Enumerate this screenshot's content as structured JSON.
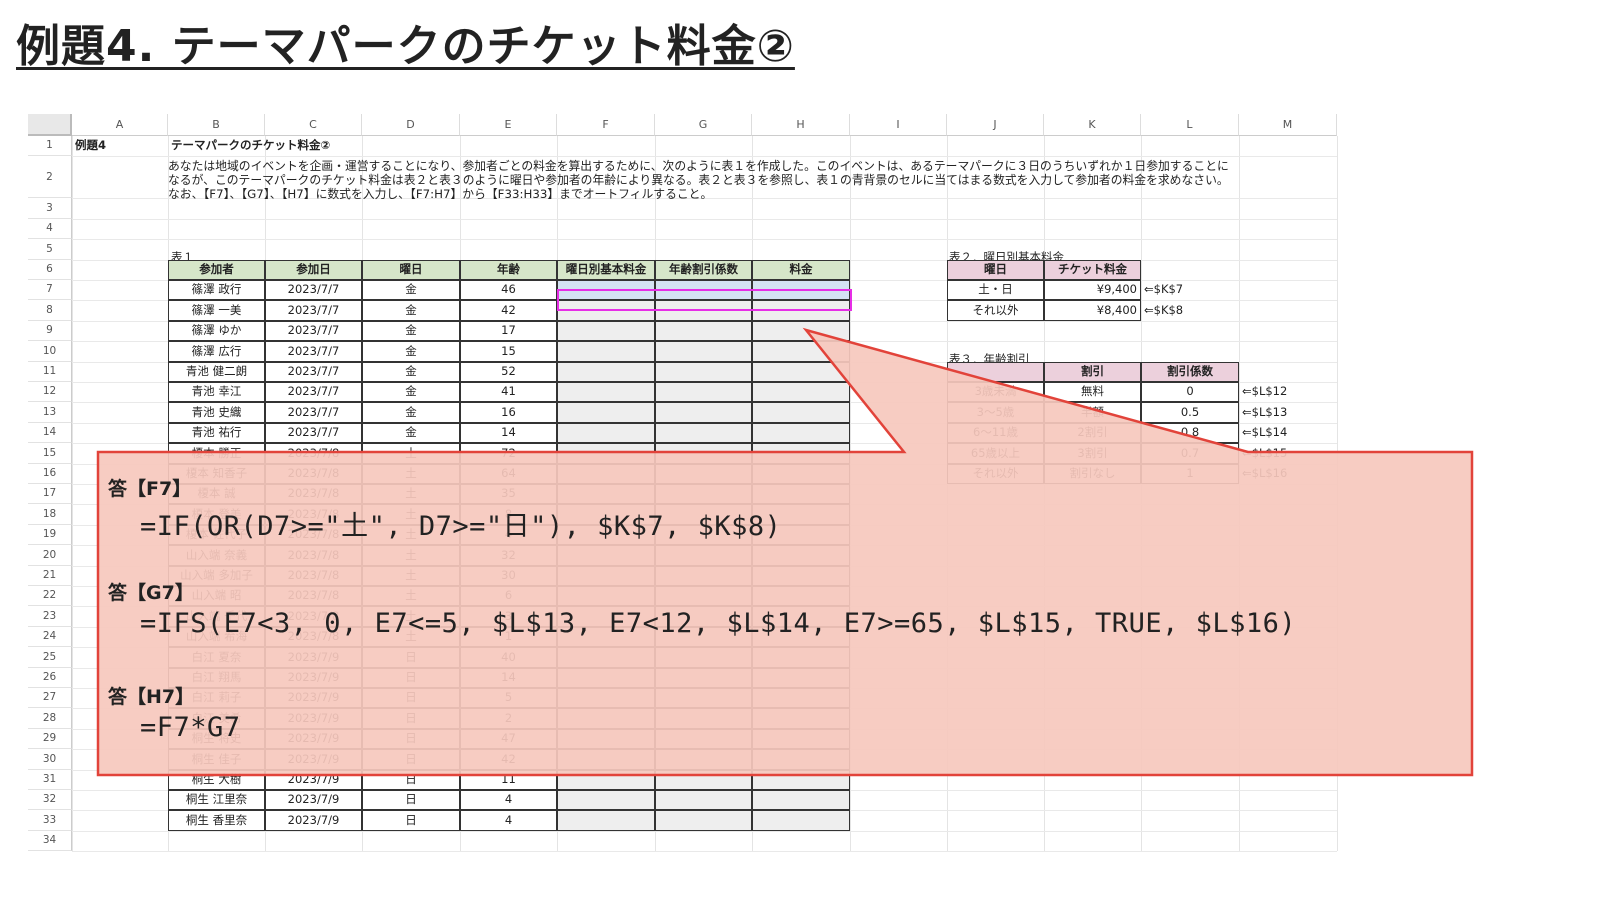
{
  "title": "例題4. テーマパークのチケット料金②",
  "sheet": {
    "columns": [
      "A",
      "B",
      "C",
      "D",
      "E",
      "F",
      "G",
      "H",
      "I",
      "J",
      "K",
      "L",
      "M"
    ],
    "rows": [
      "1",
      "2",
      "3",
      "4",
      "5",
      "6",
      "7",
      "8",
      "9",
      "10",
      "11",
      "12",
      "13",
      "14",
      "15",
      "16",
      "17",
      "18",
      "19",
      "20",
      "21",
      "22",
      "23",
      "24",
      "25",
      "26",
      "27",
      "28",
      "29",
      "30",
      "31",
      "32",
      "33",
      "34"
    ],
    "a1": "例題4",
    "b1": "テーマパークのチケット料金②",
    "description": "あなたは地域のイベントを企画・運営することになり、参加者ごとの料金を算出するために、次のように表１を作成した。このイベントは、あるテーマパークに３日のうちいずれか１日参加することになるが、このテーマパークのチケット料金は表２と表３のように曜日や参加者の年齢により異なる。表２と表３を参照し、表１の青背景のセルに当てはまる数式を入力して参加者の料金を求めなさい。なお、【F7】、【G7】、【H7】に数式を入力し、【F7:H7】から【F33:H33】までオートフィルすること。",
    "table1": {
      "caption": "表１",
      "headers": [
        "参加者",
        "参加日",
        "曜日",
        "年齢",
        "曜日別基本料金",
        "年齢割引係数",
        "料金"
      ],
      "rows": [
        [
          "篠澤 政行",
          "2023/7/7",
          "金",
          "46"
        ],
        [
          "篠澤 一美",
          "2023/7/7",
          "金",
          "42"
        ],
        [
          "篠澤 ゆか",
          "2023/7/7",
          "金",
          "17"
        ],
        [
          "篠澤 広行",
          "2023/7/7",
          "金",
          "15"
        ],
        [
          "青池 健二朗",
          "2023/7/7",
          "金",
          "52"
        ],
        [
          "青池 幸江",
          "2023/7/7",
          "金",
          "41"
        ],
        [
          "青池 史織",
          "2023/7/7",
          "金",
          "16"
        ],
        [
          "青池 祐行",
          "2023/7/7",
          "金",
          "14"
        ],
        [
          "榎本 勝正",
          "2023/7/8",
          "土",
          "72"
        ],
        [
          "榎本 知香子",
          "2023/7/8",
          "土",
          "64"
        ],
        [
          "榎本 誠",
          "2023/7/8",
          "土",
          "35"
        ],
        [
          "榎本 登美",
          "2023/7/8",
          "土",
          "8"
        ],
        [
          "榎本 佐代子",
          "2023/7/8",
          "土",
          "4"
        ],
        [
          "山入端 奈義",
          "2023/7/8",
          "土",
          "32"
        ],
        [
          "山入端 多加子",
          "2023/7/8",
          "土",
          "30"
        ],
        [
          "山入端 昭",
          "2023/7/8",
          "土",
          "6"
        ],
        [
          "山入端 千代",
          "2023/7/8",
          "土",
          "3"
        ],
        [
          "山入端 希海",
          "2023/7/8",
          "土",
          "1"
        ],
        [
          "白江 夏奈",
          "2023/7/9",
          "日",
          "40"
        ],
        [
          "白江 翔馬",
          "2023/7/9",
          "日",
          "14"
        ],
        [
          "白江 莉子",
          "2023/7/9",
          "日",
          "5"
        ],
        [
          "白江 美希",
          "2023/7/9",
          "日",
          "2"
        ],
        [
          "桐生 将史",
          "2023/7/9",
          "日",
          "47"
        ],
        [
          "桐生 佳子",
          "2023/7/9",
          "日",
          "42"
        ],
        [
          "桐生 大樹",
          "2023/7/9",
          "日",
          "11"
        ],
        [
          "桐生 江里奈",
          "2023/7/9",
          "日",
          "4"
        ],
        [
          "桐生 香里奈",
          "2023/7/9",
          "日",
          "4"
        ]
      ]
    },
    "table2": {
      "caption": "表２．曜日別基本料金",
      "headers": [
        "曜日",
        "チケット料金"
      ],
      "rows": [
        [
          "土・日",
          "¥9,400",
          "⇐$K$7"
        ],
        [
          "それ以外",
          "¥8,400",
          "⇐$K$8"
        ]
      ]
    },
    "table3": {
      "caption": "表３．年齢割引",
      "headers": [
        "",
        "割引",
        "割引係数"
      ],
      "rows": [
        [
          "3歳未満",
          "無料",
          "0",
          "⇐$L$12"
        ],
        [
          "3〜5歳",
          "半額",
          "0.5",
          "⇐$L$13"
        ],
        [
          "6〜11歳",
          "2割引",
          "0.8",
          "⇐$L$14"
        ],
        [
          "65歳以上",
          "3割引",
          "0.7",
          "⇐$L$15"
        ],
        [
          "それ以外",
          "割引なし",
          "1",
          "⇐$L$16"
        ]
      ]
    }
  },
  "answers": [
    {
      "label": "答【F7】",
      "formula": "=IF(OR(D7>=\"土\", D7>=\"日\"), $K$7, $K$8)"
    },
    {
      "label": "答【G7】",
      "formula": "=IFS(E7<3, 0, E7<=5, $L$13, E7<12, $L$14, E7>=65, $L$15, TRUE, $L$16)"
    },
    {
      "label": "答【H7】",
      "formula": "=F7*G7"
    }
  ],
  "colors": {
    "callout_fill": "#f6c8bd",
    "callout_stroke": "#e2433a",
    "selection": "#e62ee6",
    "header_green": "#d6e6c9",
    "header_pink": "#ecd0dc",
    "input_blue": "#d4e2f3"
  }
}
